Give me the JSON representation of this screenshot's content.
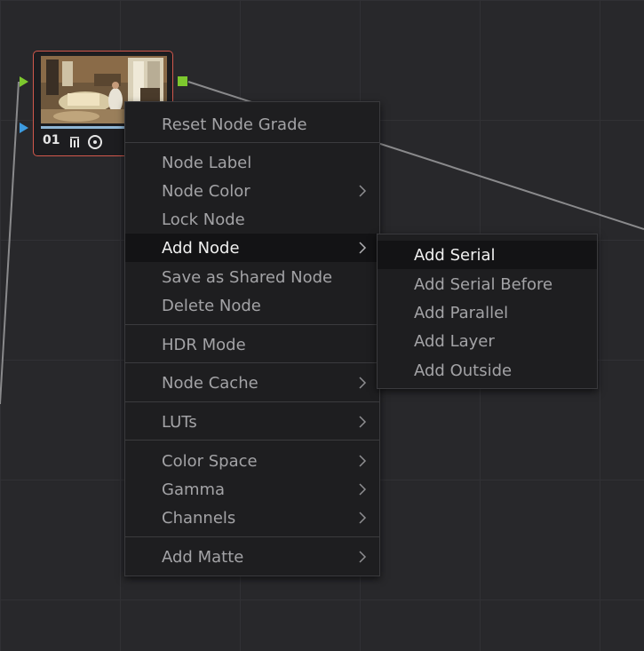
{
  "node": {
    "number": "01",
    "thumbnail_icon": "room-interior-thumbnail",
    "progress_fraction": 1.0,
    "icons": [
      "input-rgb-port-icon",
      "input-key-port-icon",
      "output-rgb-port-icon",
      "tracker-bars-icon",
      "circle-window-icon"
    ]
  },
  "context_menu": {
    "items": [
      {
        "label": "Reset Node Grade",
        "submenu": false
      },
      {
        "label": "Node Label",
        "submenu": false
      },
      {
        "label": "Node Color",
        "submenu": true
      },
      {
        "label": "Lock Node",
        "submenu": false
      },
      {
        "label": "Add Node",
        "submenu": true,
        "active": true
      },
      {
        "label": "Save as Shared Node",
        "submenu": false
      },
      {
        "label": "Delete Node",
        "submenu": false
      },
      {
        "label": "HDR Mode",
        "submenu": false
      },
      {
        "label": "Node Cache",
        "submenu": true
      },
      {
        "label": "LUTs",
        "submenu": true
      },
      {
        "label": "Color Space",
        "submenu": true
      },
      {
        "label": "Gamma",
        "submenu": true
      },
      {
        "label": "Channels",
        "submenu": true
      },
      {
        "label": "Add Matte",
        "submenu": true
      }
    ]
  },
  "submenu": {
    "items": [
      {
        "label": "Add Serial",
        "active": true
      },
      {
        "label": "Add Serial Before"
      },
      {
        "label": "Add Parallel"
      },
      {
        "label": "Add Layer"
      },
      {
        "label": "Add Outside"
      }
    ]
  },
  "colors": {
    "node_border": "#d2584c",
    "rgb_port": "#7dc82e",
    "key_port": "#3d9be0",
    "menu_bg": "#1e1e20",
    "menu_text": "#a3a3a6",
    "menu_active_text": "#f0f0f0"
  }
}
